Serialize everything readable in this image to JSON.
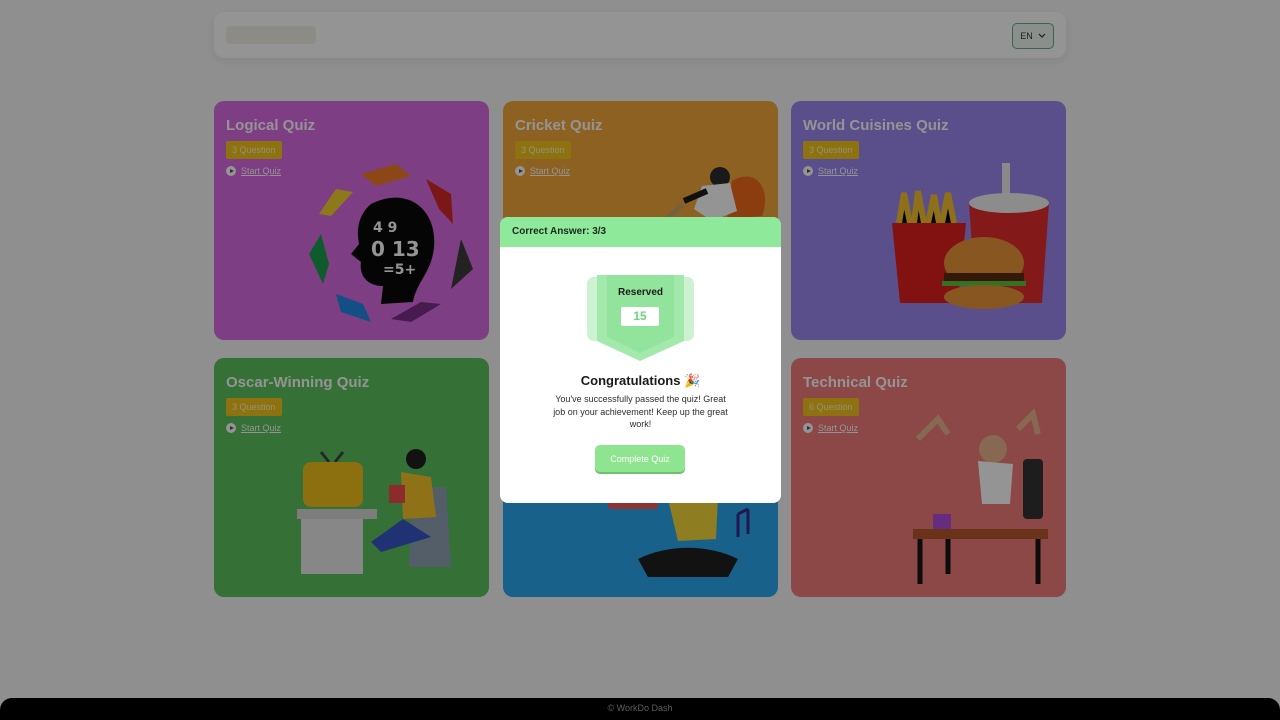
{
  "header": {
    "language": "EN"
  },
  "cards": [
    {
      "title": "Logical Quiz",
      "badge": "3 Question",
      "start": "Start Quiz",
      "bg": "#d96be2",
      "illustration": "brain-numbers-icon"
    },
    {
      "title": "Cricket Quiz",
      "badge": "3 Question",
      "start": "Start Quiz",
      "bg": "#f3a83b",
      "illustration": "cricket-player-icon"
    },
    {
      "title": "World Cuisines Quiz",
      "badge": "3 Question",
      "start": "Start Quiz",
      "bg": "#9b88ee",
      "illustration": "fast-food-icon"
    },
    {
      "title": "Oscar-Winning Quiz",
      "badge": "3 Question",
      "start": "Start Quiz",
      "bg": "#5cc15e",
      "illustration": "tv-viewer-icon"
    },
    {
      "title": "",
      "badge": "",
      "start": "",
      "bg": "#2aa7ee",
      "illustration": "music-listener-icon"
    },
    {
      "title": "Technical Quiz",
      "badge": "6 Question",
      "start": "Start Quiz",
      "bg": "#f27a7a",
      "illustration": "office-desk-icon"
    }
  ],
  "modal": {
    "header": "Correct Answer: 3/3",
    "badge_title": "Reserved",
    "badge_value": "15",
    "title": "Congratulations 🎉",
    "message": "You've successfully passed the quiz! Great job on your achievement! Keep up the great work!",
    "button": "Complete Quiz",
    "accent": "#8ee99a"
  },
  "footer": {
    "text": "© WorkDo Dash"
  }
}
